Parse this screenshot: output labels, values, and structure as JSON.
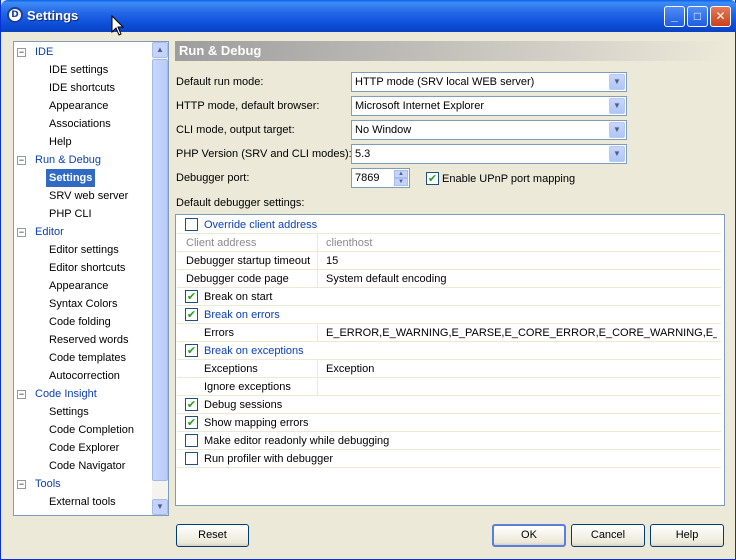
{
  "window": {
    "title": "Settings",
    "app_icon_glyph": "D",
    "controls": {
      "minimize": "_",
      "maximize": "□",
      "close": "✕"
    }
  },
  "tree": [
    {
      "label": "IDE",
      "level": 0,
      "expanded": true
    },
    {
      "label": "IDE settings",
      "level": 1
    },
    {
      "label": "IDE shortcuts",
      "level": 1
    },
    {
      "label": "Appearance",
      "level": 1
    },
    {
      "label": "Associations",
      "level": 1
    },
    {
      "label": "Help",
      "level": 1
    },
    {
      "label": "Run & Debug",
      "level": 0,
      "expanded": true
    },
    {
      "label": "Settings",
      "level": 1,
      "selected": true
    },
    {
      "label": "SRV web server",
      "level": 1
    },
    {
      "label": "PHP CLI",
      "level": 1
    },
    {
      "label": "Editor",
      "level": 0,
      "expanded": true
    },
    {
      "label": "Editor settings",
      "level": 1
    },
    {
      "label": "Editor shortcuts",
      "level": 1
    },
    {
      "label": "Appearance",
      "level": 1
    },
    {
      "label": "Syntax Colors",
      "level": 1
    },
    {
      "label": "Code folding",
      "level": 1
    },
    {
      "label": "Reserved words",
      "level": 1
    },
    {
      "label": "Code templates",
      "level": 1
    },
    {
      "label": "Autocorrection",
      "level": 1
    },
    {
      "label": "Code Insight",
      "level": 0,
      "expanded": true
    },
    {
      "label": "Settings",
      "level": 1
    },
    {
      "label": "Code Completion",
      "level": 1
    },
    {
      "label": "Code Explorer",
      "level": 1
    },
    {
      "label": "Code Navigator",
      "level": 1
    },
    {
      "label": "Tools",
      "level": 0,
      "expanded": true
    },
    {
      "label": "External tools",
      "level": 1
    }
  ],
  "panel": {
    "header": "Run & Debug",
    "fields": [
      {
        "label": "Default run mode:",
        "value": "HTTP mode (SRV local WEB server)"
      },
      {
        "label": "HTTP mode, default browser:",
        "value": "Microsoft Internet Explorer"
      },
      {
        "label": "CLI mode, output target:",
        "value": "No Window"
      },
      {
        "label": "PHP Version (SRV and CLI modes):",
        "value": "5.3"
      }
    ],
    "debugger_port": {
      "label": "Debugger port:",
      "value": "7869"
    },
    "upnp": {
      "label": "Enable UPnP port mapping",
      "checked": true
    },
    "defaults_label": "Default debugger settings:"
  },
  "grid": [
    {
      "label": "Override client address",
      "check": false,
      "blue": true,
      "value": ""
    },
    {
      "label": "Client address",
      "muted": true,
      "value": "clienthost",
      "value_muted": true
    },
    {
      "label": "Debugger startup timeout",
      "value": "15"
    },
    {
      "label": "Debugger code page",
      "value": "System default encoding"
    },
    {
      "label": "Break on start",
      "check": true,
      "value": ""
    },
    {
      "label": "Break on errors",
      "check": true,
      "blue": true,
      "value": ""
    },
    {
      "label": "Errors",
      "indent": true,
      "value": "E_ERROR,E_WARNING,E_PARSE,E_CORE_ERROR,E_CORE_WARNING,E_CO..."
    },
    {
      "label": "Break on exceptions",
      "check": true,
      "blue": true,
      "value": ""
    },
    {
      "label": "Exceptions",
      "indent": true,
      "value": "Exception"
    },
    {
      "label": "Ignore exceptions",
      "indent": true,
      "value": ""
    },
    {
      "label": "Debug sessions",
      "check": true,
      "value": ""
    },
    {
      "label": "Show mapping errors",
      "check": true,
      "value": ""
    },
    {
      "label": "Make editor readonly while debugging",
      "check": false,
      "value": ""
    },
    {
      "label": "Run profiler with debugger",
      "check": false,
      "value": ""
    }
  ],
  "buttons": {
    "reset": "Reset",
    "ok": "OK",
    "cancel": "Cancel",
    "help": "Help"
  },
  "colors": {
    "selection": "#316ac5",
    "link_blue": "#0a3fb5",
    "check_green": "#21a121"
  }
}
